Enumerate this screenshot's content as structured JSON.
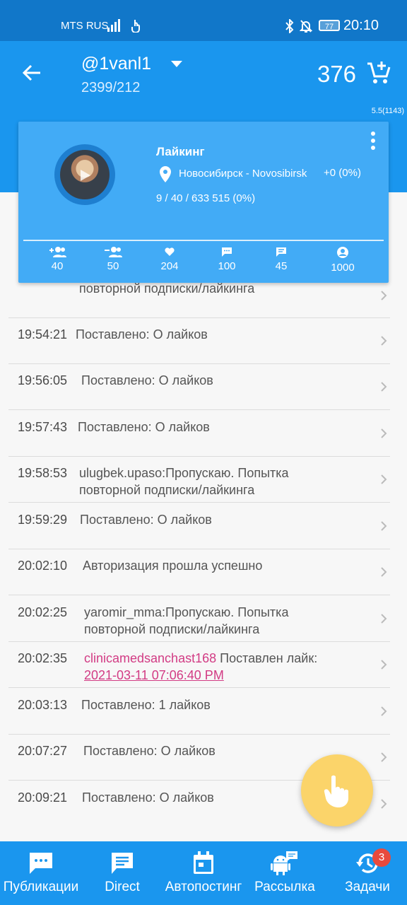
{
  "status_bar": {
    "carrier": "MTS RUS",
    "battery": "77",
    "time": "20:10"
  },
  "header": {
    "account": "@1vanl1",
    "counts": "2399/212",
    "balance": "376",
    "version": "5.5(1143)"
  },
  "card": {
    "title": "Лайкинг",
    "location": "Новосибирск - Novosibirsk",
    "delta": "+0 (0%)",
    "stats": "9 / 40 / 633 515 (0%)",
    "metrics": [
      {
        "icon": "follow-add-icon",
        "value": "40"
      },
      {
        "icon": "unfollow-icon",
        "value": "50"
      },
      {
        "icon": "heart-icon",
        "value": "204"
      },
      {
        "icon": "comment-icon",
        "value": "100"
      },
      {
        "icon": "message-icon",
        "value": "45"
      },
      {
        "icon": "profile-icon",
        "value": "1000"
      }
    ]
  },
  "log": {
    "partial_text": "повторной подписки/лайкинга",
    "entries": [
      {
        "time": "19:54:21",
        "text": "Поставлено: О лайков"
      },
      {
        "time": "19:56:05",
        "text": "Поставлено: О лайков"
      },
      {
        "time": "19:57:43",
        "text": "Поставлено: О лайков"
      },
      {
        "time": "19:58:53",
        "text": "ulugbek.upaso:Пропускаю. Попытка повторной подписки/лайкинга"
      },
      {
        "time": "19:59:29",
        "text": "Поставлено: О лайков"
      },
      {
        "time": "20:02:10",
        "text": "Авторизация прошла успешно"
      },
      {
        "time": "20:02:25",
        "text": "yaromir_mma:Пропускаю. Попытка повторной подписки/лайкинга"
      },
      {
        "time": "20:02:35",
        "user": "clinicamedsanchast168",
        "text_mid": "Поставлен лайк:",
        "date": "2021-03-11 07:06:40 PM"
      },
      {
        "time": "20:03:13",
        "text": "Поставлено: 1 лайков"
      },
      {
        "time": "20:07:27",
        "text": "Поставлено: О лайков"
      },
      {
        "time": "20:09:21",
        "text": "Поставлено: О лайков"
      }
    ]
  },
  "nav": {
    "items": [
      {
        "label": "Публикации"
      },
      {
        "label": "Direct"
      },
      {
        "label": "Автопостинг"
      },
      {
        "label": "Рассылка"
      },
      {
        "label": "Задачи"
      }
    ],
    "badge": "3"
  },
  "colors": {
    "primary": "#1a96ee",
    "card": "#42abf6",
    "fab": "#fbd46a",
    "link": "#d23b84",
    "badge": "#e84a3d"
  }
}
